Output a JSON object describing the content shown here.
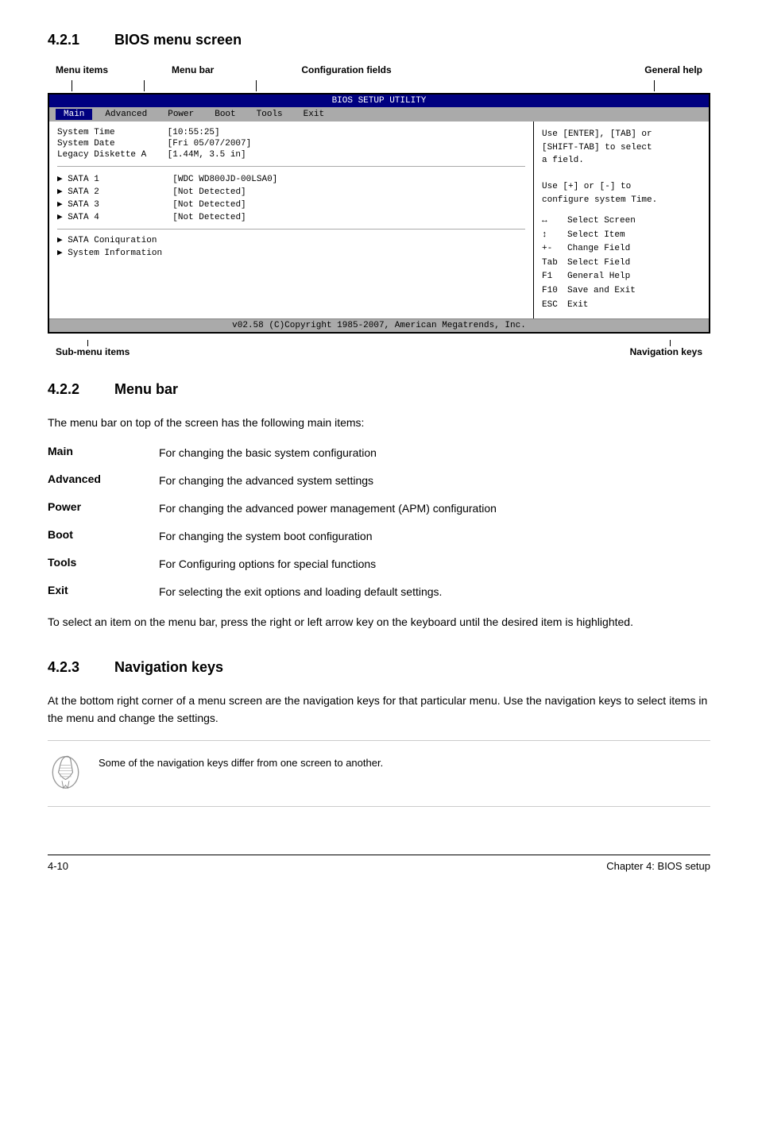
{
  "sections": {
    "s421": {
      "number": "4.2.1",
      "title": "BIOS menu screen"
    },
    "s422": {
      "number": "4.2.2",
      "title": "Menu bar"
    },
    "s423": {
      "number": "4.2.3",
      "title": "Navigation keys"
    }
  },
  "diagram": {
    "labels": {
      "menu_items": "Menu items",
      "menu_bar": "Menu bar",
      "config_fields": "Configuration fields",
      "general_help": "General help",
      "sub_menu_items": "Sub-menu items",
      "navigation_keys": "Navigation keys"
    }
  },
  "bios": {
    "title": "BIOS SETUP UTILITY",
    "nav_items": [
      "Main",
      "Advanced",
      "Power",
      "Boot",
      "Tools",
      "Exit"
    ],
    "active_nav": "Main",
    "left_top": {
      "items": [
        {
          "label": "System Time",
          "value": "[10:55:25]"
        },
        {
          "label": "System Date",
          "value": "[Fri 05/07/2007]"
        },
        {
          "label": "Legacy Diskette A",
          "value": "[1.44M, 3.5 in]"
        }
      ]
    },
    "left_mid": {
      "items": [
        {
          "label": "▶ SATA 1",
          "value": "[WDC WD800JD-00LSA0]"
        },
        {
          "label": "▶ SATA 2",
          "value": "[Not Detected]"
        },
        {
          "label": "▶ SATA 3",
          "value": "[Not Detected]"
        },
        {
          "label": "▶ SATA 4",
          "value": "[Not Detected]"
        }
      ]
    },
    "left_bottom": {
      "items": [
        "▶ SATA Coniquration",
        "▶ System Information"
      ]
    },
    "right_top": [
      "Use [ENTER], [TAB] or",
      "[SHIFT-TAB] to select",
      "a field.",
      "",
      "Use [+] or [-] to",
      "configure system Time."
    ],
    "right_bottom": {
      "keys": [
        {
          "symbol": "↔",
          "desc": "Select Screen"
        },
        {
          "symbol": "↕",
          "desc": "Select Item"
        },
        {
          "symbol": "+-",
          "desc": "Change Field"
        },
        {
          "symbol": "Tab",
          "desc": "Select Field"
        },
        {
          "symbol": "F1",
          "desc": "General Help"
        },
        {
          "symbol": "F10",
          "desc": "Save and Exit"
        },
        {
          "symbol": "ESC",
          "desc": "Exit"
        }
      ]
    },
    "footer": "v02.58 (C)Copyright 1985-2007, American Megatrends, Inc."
  },
  "menu_bar_section": {
    "intro": "The menu bar on top of the screen has the following main items:",
    "items": [
      {
        "name": "Main",
        "desc": "For changing the basic system configuration"
      },
      {
        "name": "Advanced",
        "desc": "For changing the advanced system settings"
      },
      {
        "name": "Power",
        "desc": "For changing the advanced power management (APM) configuration"
      },
      {
        "name": "Boot",
        "desc": "For changing the system boot configuration"
      },
      {
        "name": "Tools",
        "desc": "For Configuring options for special functions"
      },
      {
        "name": "Exit",
        "desc": "For selecting the exit options and loading default settings."
      }
    ],
    "footer_text": "To select an item on the menu bar, press the right or left arrow key on the keyboard until the desired item is highlighted."
  },
  "nav_keys_section": {
    "intro": "At the bottom right corner of a menu screen are the navigation keys for that particular menu. Use the navigation keys to select items in the menu and change the settings.",
    "note": "Some of the navigation keys differ from one screen to another."
  },
  "footer": {
    "page": "4-10",
    "chapter": "Chapter 4: BIOS setup"
  }
}
